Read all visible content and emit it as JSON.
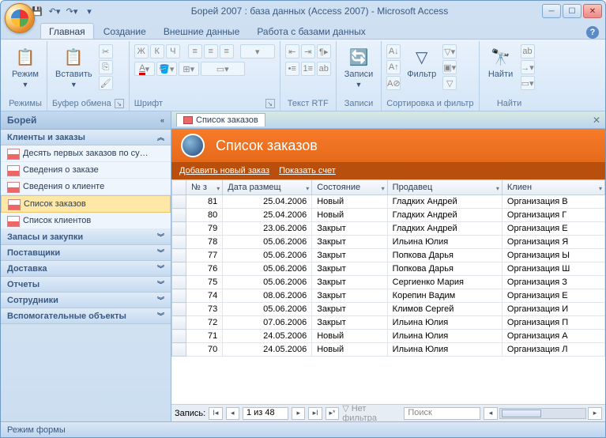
{
  "window": {
    "title": "Борей 2007 : база данных (Access 2007) - Microsoft Access"
  },
  "tabs": {
    "home": "Главная",
    "create": "Создание",
    "external": "Внешние данные",
    "db_tools": "Работа с базами данных"
  },
  "ribbon": {
    "modes": {
      "mode_btn": "Режим",
      "label": "Режимы"
    },
    "clipboard": {
      "paste_btn": "Вставить",
      "label": "Буфер обмена"
    },
    "font": {
      "label": "Шрифт",
      "bold": "Ж",
      "italic": "К",
      "underline": "Ч"
    },
    "rtf": {
      "label": "Текст RTF"
    },
    "records": {
      "btn": "Записи",
      "label": "Записи"
    },
    "sortfilter": {
      "filter_btn": "Фильтр",
      "label": "Сортировка и фильтр"
    },
    "find": {
      "btn": "Найти",
      "label": "Найти"
    }
  },
  "nav": {
    "title": "Борей",
    "groups": {
      "clients_orders": {
        "label": "Клиенты и заказы",
        "items": [
          "Десять первых заказов по су…",
          "Сведения о заказе",
          "Сведения о клиенте",
          "Список заказов",
          "Список клиентов"
        ],
        "selected_index": 3
      },
      "stock": "Запасы и закупки",
      "suppliers": "Поставщики",
      "delivery": "Доставка",
      "reports": "Отчеты",
      "employees": "Сотрудники",
      "aux": "Вспомогательные объекты"
    }
  },
  "doc": {
    "tab_label": "Список заказов",
    "header_title": "Список заказов",
    "toolbar": {
      "add": "Добавить новый заказ",
      "show_invoice": "Показать счет"
    },
    "columns": [
      "№ з",
      "Дата размещ",
      "Состояние",
      "Продавец",
      "Клиен"
    ],
    "rows": [
      {
        "id": 81,
        "date": "25.04.2006",
        "status": "Новый",
        "seller": "Гладких Андрей",
        "client": "Организация В"
      },
      {
        "id": 80,
        "date": "25.04.2006",
        "status": "Новый",
        "seller": "Гладких Андрей",
        "client": "Организация Г"
      },
      {
        "id": 79,
        "date": "23.06.2006",
        "status": "Закрыт",
        "seller": "Гладких Андрей",
        "client": "Организация Е"
      },
      {
        "id": 78,
        "date": "05.06.2006",
        "status": "Закрыт",
        "seller": "Ильина Юлия",
        "client": "Организация Я"
      },
      {
        "id": 77,
        "date": "05.06.2006",
        "status": "Закрыт",
        "seller": "Попкова Дарья",
        "client": "Организация Ы"
      },
      {
        "id": 76,
        "date": "05.06.2006",
        "status": "Закрыт",
        "seller": "Попкова Дарья",
        "client": "Организация Ш"
      },
      {
        "id": 75,
        "date": "05.06.2006",
        "status": "Закрыт",
        "seller": "Сергиенко Мария",
        "client": "Организация З"
      },
      {
        "id": 74,
        "date": "08.06.2006",
        "status": "Закрыт",
        "seller": "Корепин Вадим",
        "client": "Организация Е"
      },
      {
        "id": 73,
        "date": "05.06.2006",
        "status": "Закрыт",
        "seller": "Климов Сергей",
        "client": "Организация И"
      },
      {
        "id": 72,
        "date": "07.06.2006",
        "status": "Закрыт",
        "seller": "Ильина Юлия",
        "client": "Организация П"
      },
      {
        "id": 71,
        "date": "24.05.2006",
        "status": "Новый",
        "seller": "Ильина Юлия",
        "client": "Организация А"
      },
      {
        "id": 70,
        "date": "24.05.2006",
        "status": "Новый",
        "seller": "Ильина Юлия",
        "client": "Организация Л"
      }
    ]
  },
  "recnav": {
    "label": "Запись:",
    "position": "1 из 48",
    "no_filter": "Нет фильтра",
    "search": "Поиск"
  },
  "status": {
    "mode": "Режим формы"
  }
}
